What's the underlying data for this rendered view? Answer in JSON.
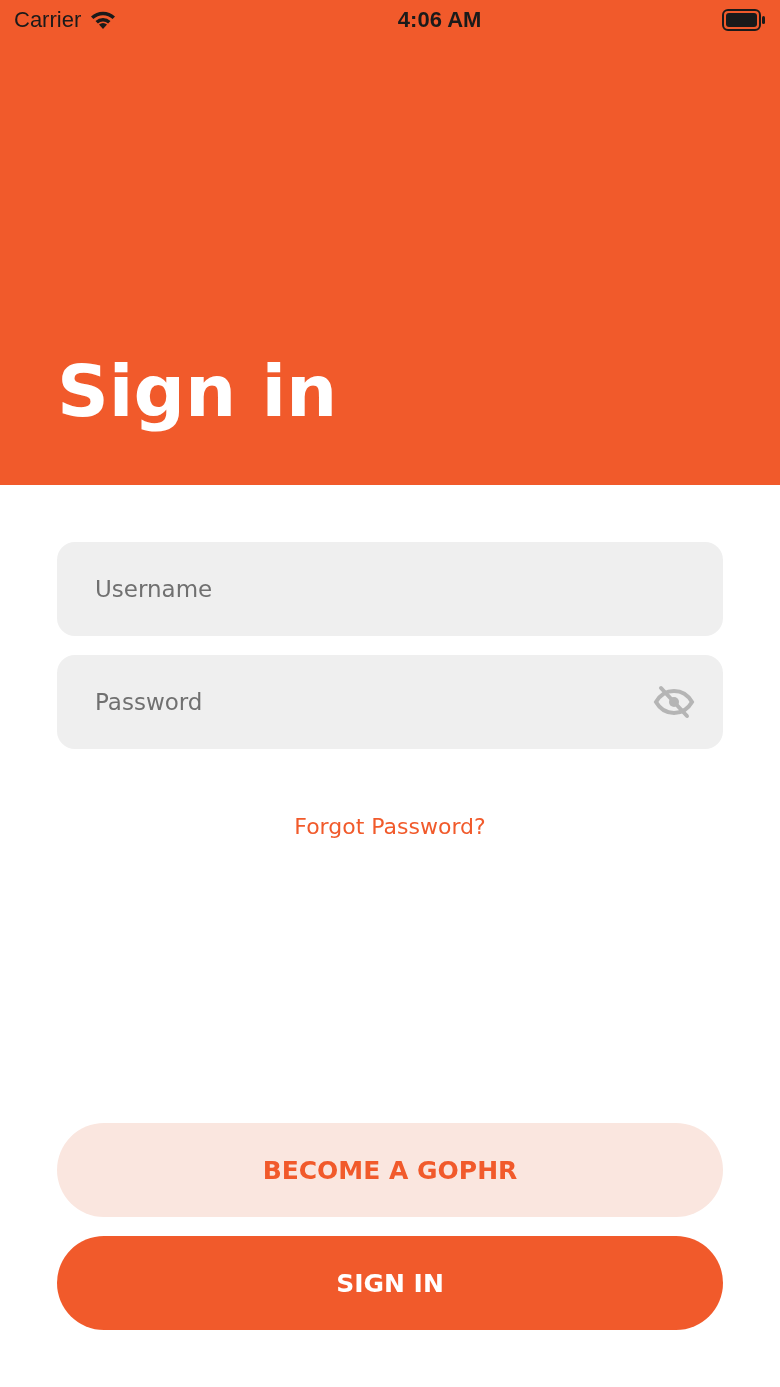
{
  "status_bar": {
    "carrier": "Carrier",
    "time": "4:06 AM"
  },
  "header": {
    "title": "Sign in"
  },
  "fields": [
    {
      "kind": "text",
      "placeholder": "Username"
    },
    {
      "kind": "password",
      "placeholder": "Password"
    }
  ],
  "forgot_link": "Forgot Password?",
  "buttons": [
    {
      "kind": "secondary",
      "label": "BECOME A GOPHR"
    },
    {
      "kind": "primary",
      "label": "SIGN IN"
    }
  ]
}
